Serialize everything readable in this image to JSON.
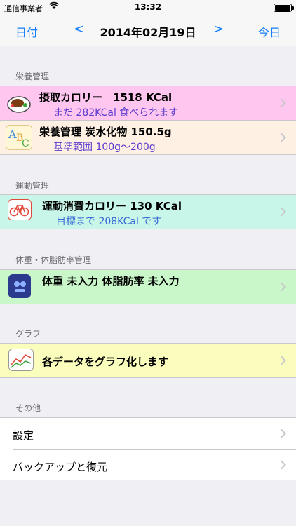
{
  "status": {
    "carrier": "通信事業者",
    "time": "13:32"
  },
  "nav": {
    "left_label": "日付",
    "prev_symbol": "<",
    "title": "2014年02月19日",
    "next_symbol": ">",
    "right_label": "今日"
  },
  "sections": {
    "nutrition": {
      "header": "栄養管理"
    },
    "exercise": {
      "header": "運動管理"
    },
    "weight": {
      "header": "体重・体脂肪率管理"
    },
    "graph": {
      "header": "グラフ"
    },
    "other": {
      "header": "その他"
    }
  },
  "cells": {
    "calorie": {
      "main": "摂取カロリー　1518 KCal",
      "sub": "まだ 282KCal 食べられます",
      "bg": "#ffc7ef",
      "icon": "food-plate-icon"
    },
    "nutrient": {
      "main": "栄養管理  炭水化物 150.5g",
      "sub": "基準範囲 100g〜200g",
      "bg": "#fff0e4",
      "icon": "abc-letters-icon"
    },
    "burn": {
      "main": "運動消費カロリー  130 KCal",
      "sub": "目標まで 208KCal です",
      "bg": "#c8f6e8",
      "icon": "bicycle-icon"
    },
    "weight": {
      "main": "体重 未入力 体脂肪率 未入力",
      "bg": "#c9f7c9",
      "icon": "scale-icon"
    },
    "graph": {
      "main": "各データをグラフ化します",
      "bg": "#fbfdbd",
      "icon": "line-graph-icon"
    },
    "settings": {
      "label": "設定"
    },
    "backup": {
      "label": "バックアップと復元"
    }
  },
  "colors": {
    "accent": "#147efb",
    "subtext": "#5a3ccf"
  }
}
